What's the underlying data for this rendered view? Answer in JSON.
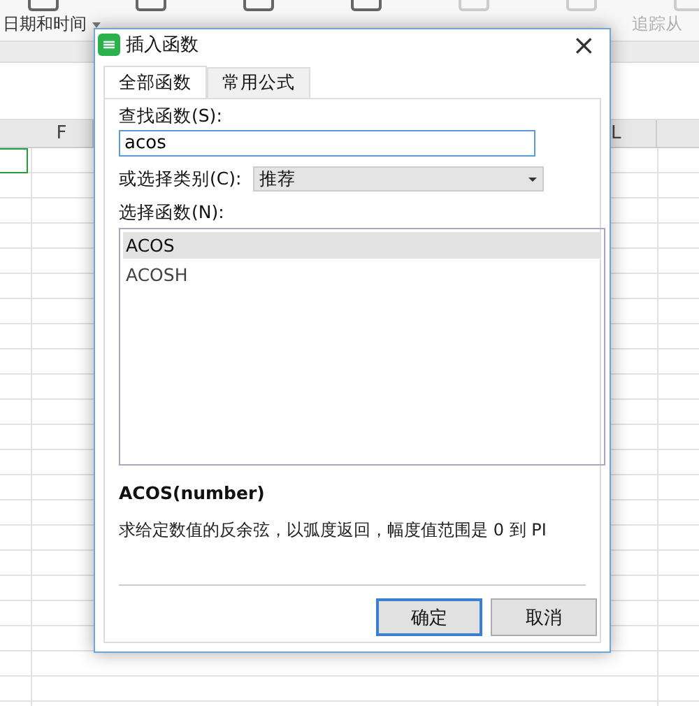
{
  "ribbon": {
    "groups": [
      {
        "label": "日期和时间",
        "disabled": false,
        "dropdown": true
      },
      {
        "label": "追踪从",
        "disabled": true,
        "dropdown": false
      }
    ]
  },
  "sheet": {
    "column_headers": [
      "F",
      "L"
    ],
    "selected_cell": true
  },
  "dialog": {
    "title": "插入函数",
    "close": "×",
    "tabs": [
      {
        "label": "全部函数",
        "selected": true
      },
      {
        "label": "常用公式",
        "selected": false
      }
    ],
    "search": {
      "label": "查找函数(S):",
      "value": "acos"
    },
    "category": {
      "label": "或选择类别(C):",
      "value": "推荐"
    },
    "functions": {
      "label": "选择函数(N):",
      "items": [
        {
          "name": "ACOS",
          "selected": true
        },
        {
          "name": "ACOSH",
          "selected": false
        }
      ]
    },
    "signature": "ACOS(number)",
    "description": "求给定数值的反余弦，以弧度返回，幅度值范围是 0 到 PI",
    "buttons": [
      {
        "label": "确定",
        "default": true
      },
      {
        "label": "取消",
        "default": false
      }
    ]
  }
}
